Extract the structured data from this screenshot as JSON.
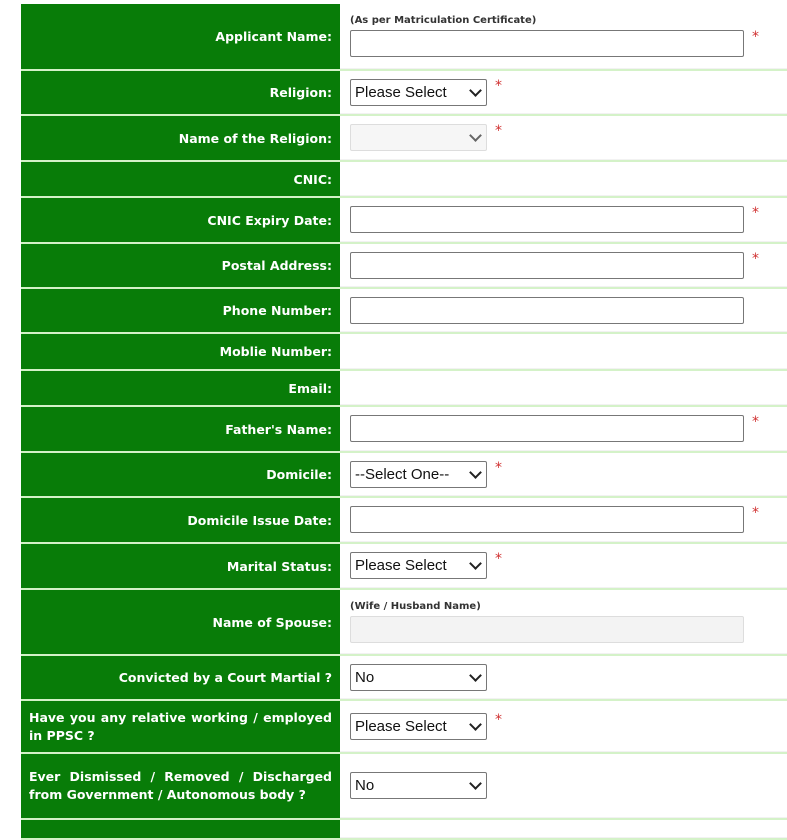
{
  "rows": [
    {
      "label": "Applicant Name:",
      "hint": "(As per Matriculation Certificate)",
      "type": "input",
      "required": true
    },
    {
      "label": "Religion:",
      "type": "select",
      "value": "Please Select",
      "required": true
    },
    {
      "label": "Name of the Religion:",
      "type": "select-disabled",
      "value": "",
      "required": true
    },
    {
      "label": "CNIC:",
      "type": "none"
    },
    {
      "label": "CNIC Expiry Date:",
      "type": "input",
      "required": true
    },
    {
      "label": "Postal Address:",
      "type": "input",
      "required": true
    },
    {
      "label": "Phone Number:",
      "type": "input",
      "required": false
    },
    {
      "label": "Moblie Number:",
      "type": "none"
    },
    {
      "label": "Email:",
      "type": "none"
    },
    {
      "label": "Father's Name:",
      "type": "input",
      "required": true
    },
    {
      "label": "Domicile:",
      "type": "select",
      "value": "--Select One--",
      "required": true
    },
    {
      "label": "Domicile Issue Date:",
      "type": "input",
      "required": true
    },
    {
      "label": "Marital Status:",
      "type": "select",
      "value": "Please Select",
      "required": true
    },
    {
      "label": "Name of Spouse:",
      "hint": "(Wife / Husband Name)",
      "type": "input-disabled",
      "required": false
    },
    {
      "label": "Convicted by a Court Martial ?",
      "type": "select",
      "value": "No",
      "required": false
    },
    {
      "label": "Have you any relative working / employed in PPSC ?",
      "type": "select",
      "value": "Please Select",
      "required": true
    },
    {
      "label": "Ever Dismissed / Removed / Discharged from Government / Autonomous body ?",
      "type": "select",
      "value": "No",
      "required": false
    },
    {
      "label": "",
      "type": "none"
    }
  ],
  "required_mark": "*",
  "colors": {
    "label_bg": "#087c08",
    "separator": "#d4f2c8",
    "required": "#d03030"
  }
}
